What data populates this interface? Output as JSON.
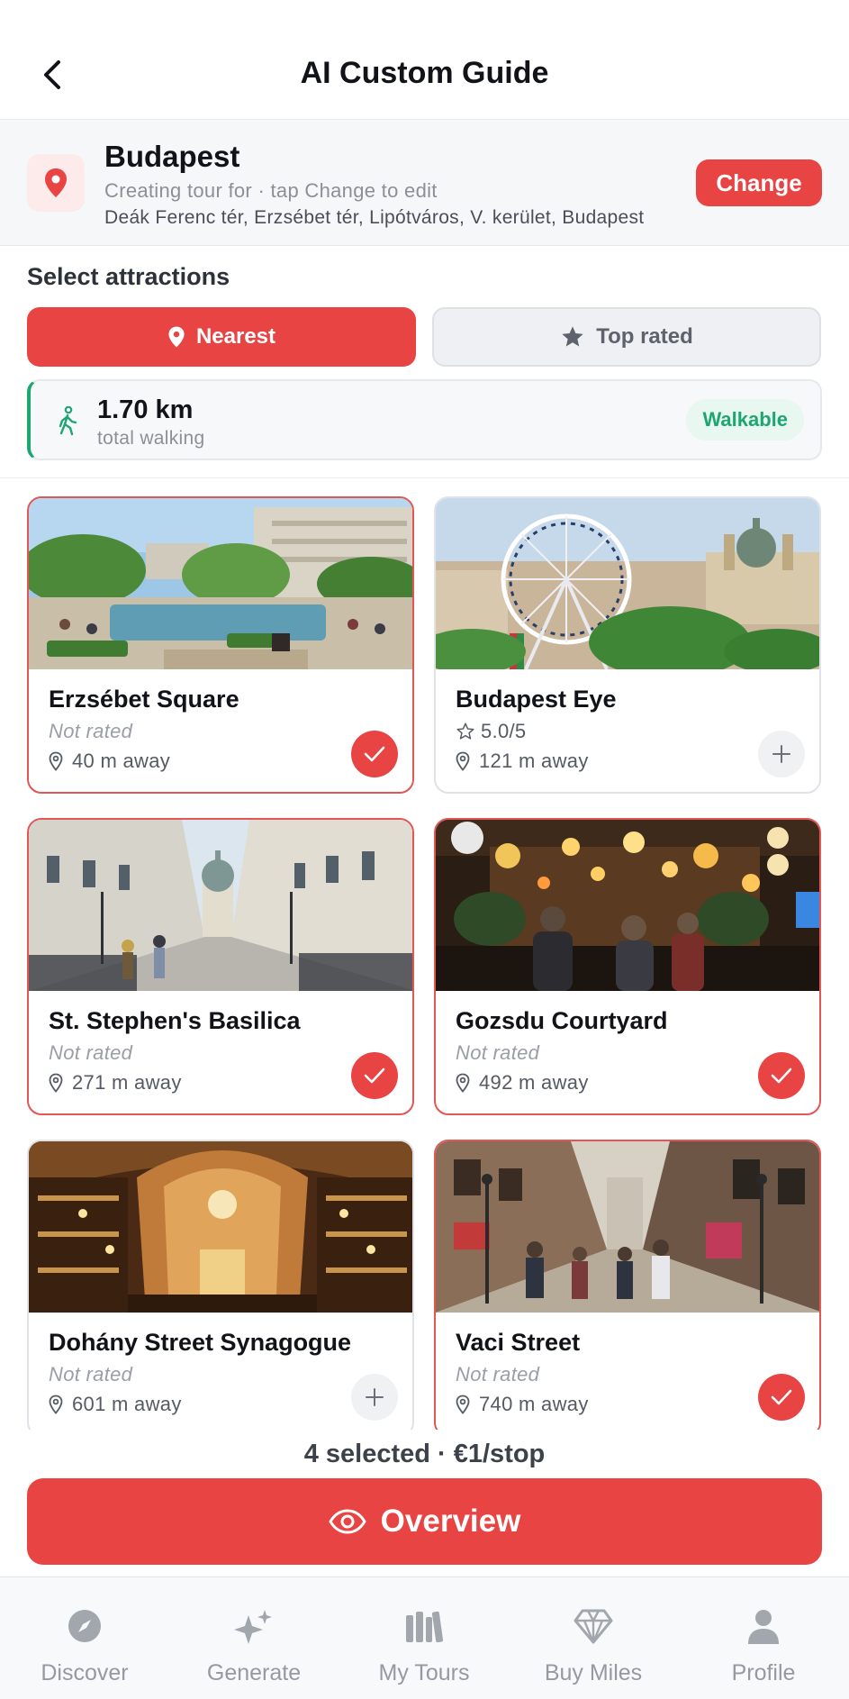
{
  "header": {
    "title": "AI Custom Guide",
    "back_icon": "chevron-left-icon"
  },
  "location": {
    "city": "Budapest",
    "subtitle": "Creating tour for · tap Change to edit",
    "address": "Deák Ferenc tér, Erzsébet tér, Lipótváros, V. kerület, Budapest",
    "change_label": "Change",
    "icon": "map-pin-icon"
  },
  "attractions": {
    "title": "Select attractions",
    "sort_options": [
      {
        "label": "Nearest",
        "icon": "map-pin-icon",
        "active": true
      },
      {
        "label": "Top rated",
        "icon": "star-icon",
        "active": false
      }
    ]
  },
  "walking": {
    "distance": "1.70 km",
    "label": "total walking",
    "badge": "Walkable",
    "accent_color": "#1ea672"
  },
  "cards": [
    {
      "name": "Erzsébet Square",
      "rating": "Not rated",
      "distance": "40 m away",
      "selected": true,
      "rated": false
    },
    {
      "name": "Budapest Eye",
      "rating": "5.0/5",
      "distance": "121 m away",
      "selected": false,
      "rated": true
    },
    {
      "name": "St. Stephen's Basilica",
      "rating": "Not rated",
      "distance": "271 m away",
      "selected": true,
      "rated": false
    },
    {
      "name": "Gozsdu Courtyard",
      "rating": "Not rated",
      "distance": "492 m away",
      "selected": true,
      "rated": false
    },
    {
      "name": "Dohány Street Synagogue",
      "rating": "Not rated",
      "distance": "601 m away",
      "selected": false,
      "rated": false
    },
    {
      "name": "Vaci Street",
      "rating": "Not rated",
      "distance": "740 m away",
      "selected": true,
      "rated": false
    }
  ],
  "footer": {
    "summary": "4 selected · €1/stop",
    "overview_label": "Overview",
    "overview_icon": "eye-icon"
  },
  "tabs": [
    {
      "label": "Discover",
      "icon": "compass-icon"
    },
    {
      "label": "Generate",
      "icon": "sparkles-icon"
    },
    {
      "label": "My Tours",
      "icon": "library-icon"
    },
    {
      "label": "Buy Miles",
      "icon": "diamond-icon"
    },
    {
      "label": "Profile",
      "icon": "person-icon"
    }
  ],
  "colors": {
    "accent": "#e94444",
    "walkable": "#1ea672",
    "text_muted": "#8b8f98"
  }
}
